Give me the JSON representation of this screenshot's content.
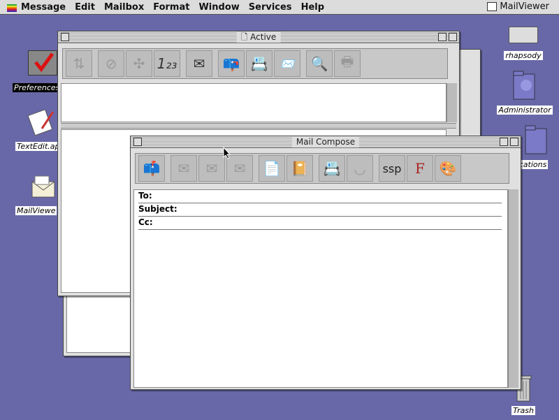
{
  "menubar": {
    "items": [
      "Message",
      "Edit",
      "Mailbox",
      "Format",
      "Window",
      "Services",
      "Help"
    ],
    "app_name": "MailViewer"
  },
  "desktop": {
    "left_icons": [
      {
        "name": "preferences",
        "label": "Preferences"
      },
      {
        "name": "textedit",
        "label": "TextEdit.ap"
      },
      {
        "name": "mailviewer",
        "label": "MailViewe"
      }
    ],
    "right_icons": [
      {
        "name": "rhapsody",
        "label": "rhapsody"
      },
      {
        "name": "administrator",
        "label": "Administrator"
      },
      {
        "name": "applications",
        "label": "ications"
      },
      {
        "name": "trash",
        "label": "Trash"
      }
    ]
  },
  "active_window": {
    "title": "Active"
  },
  "compose_window": {
    "title": "Mail Compose",
    "fields": {
      "to": "To:",
      "subject": "Subject:",
      "cc": "Cc:"
    }
  }
}
